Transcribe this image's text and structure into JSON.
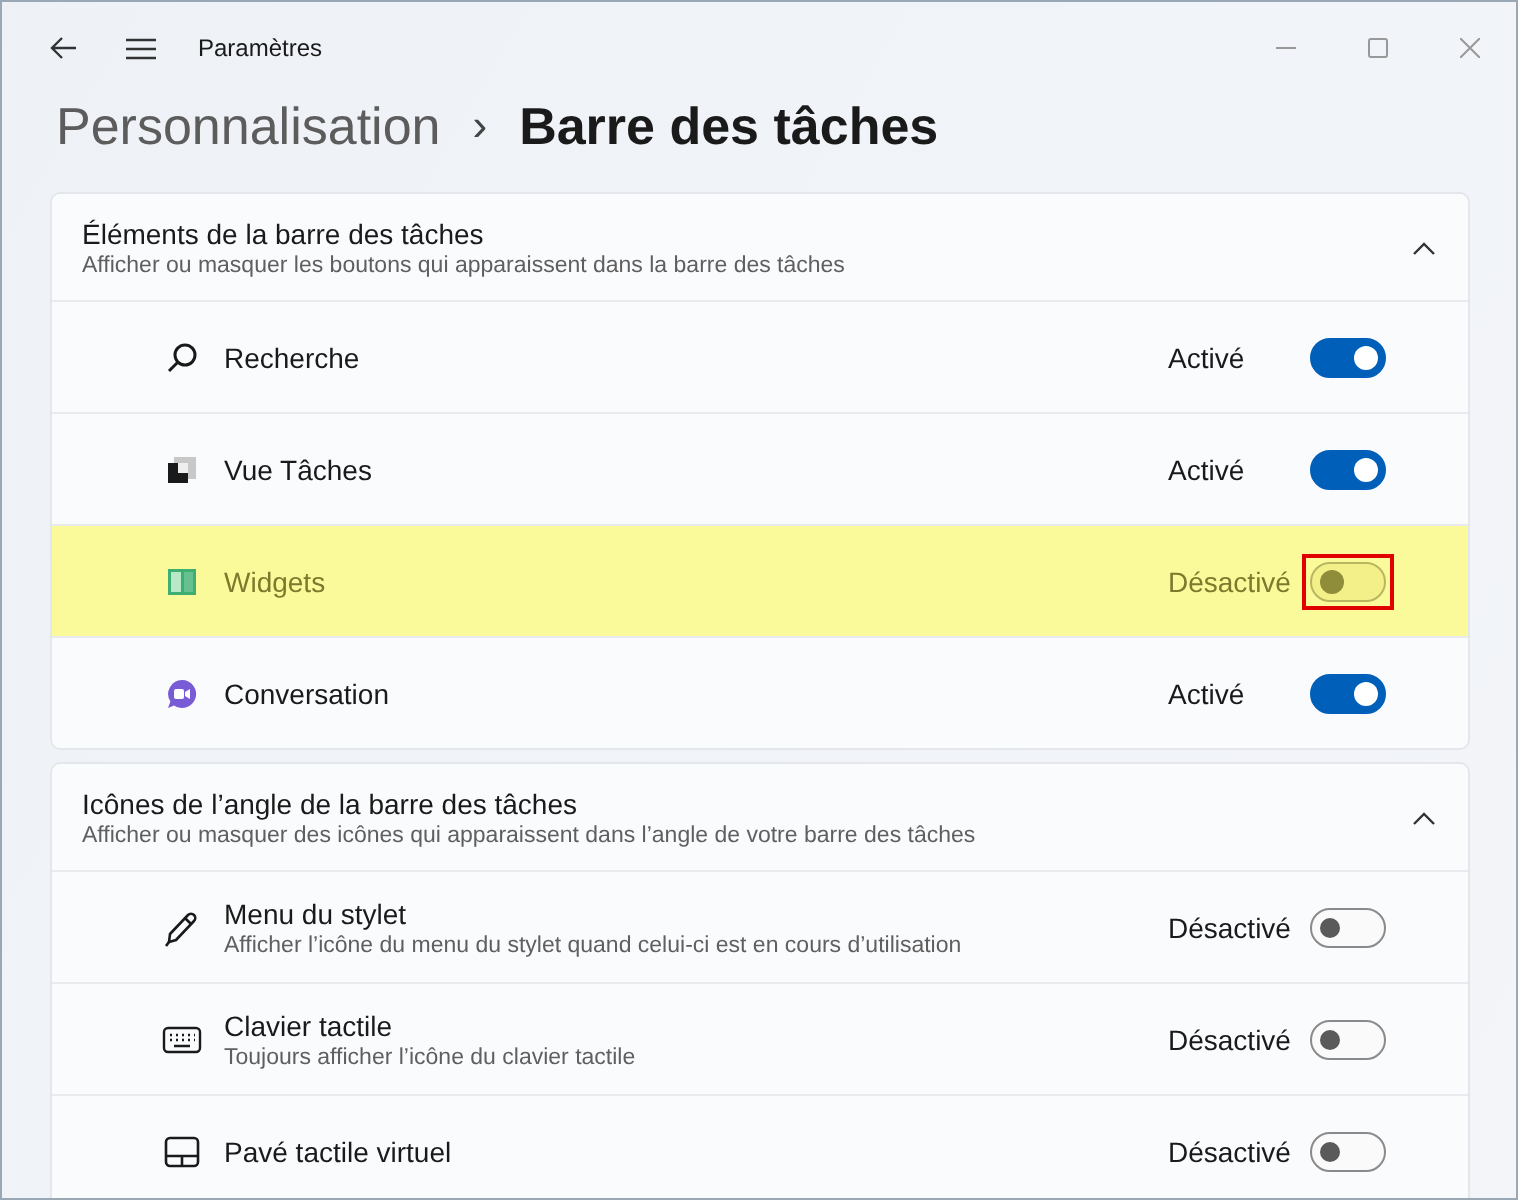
{
  "window": {
    "title": "Paramètres"
  },
  "breadcrumb": {
    "parent": "Personnalisation",
    "separator": "›",
    "current": "Barre des tâches"
  },
  "sections": [
    {
      "title": "Éléments de la barre des tâches",
      "description": "Afficher ou masquer les boutons qui apparaissent dans la barre des tâches",
      "expanded": true,
      "rows": [
        {
          "kind": "search",
          "label": "Recherche",
          "status": "Activé",
          "on": true,
          "highlighted": false
        },
        {
          "kind": "taskview",
          "label": "Vue Tâches",
          "status": "Activé",
          "on": true,
          "highlighted": false
        },
        {
          "kind": "widgets",
          "label": "Widgets",
          "status": "Désactivé",
          "on": false,
          "highlighted": true
        },
        {
          "kind": "chat",
          "label": "Conversation",
          "status": "Activé",
          "on": true,
          "highlighted": false
        }
      ]
    },
    {
      "title": "Icônes de l’angle de la barre des tâches",
      "description": "Afficher ou masquer des icônes qui apparaissent dans l’angle de votre barre des tâches",
      "expanded": true,
      "rows": [
        {
          "kind": "pen",
          "label": "Menu du stylet",
          "description": "Afficher l’icône du menu du stylet quand celui-ci est en cours d’utilisation",
          "status": "Désactivé",
          "on": false,
          "highlighted": false
        },
        {
          "kind": "keyboard",
          "label": "Clavier tactile",
          "description": "Toujours afficher l’icône du clavier tactile",
          "status": "Désactivé",
          "on": false,
          "highlighted": false
        },
        {
          "kind": "touchpad",
          "label": "Pavé tactile virtuel",
          "status": "Désactivé",
          "on": false,
          "highlighted": false
        }
      ]
    }
  ]
}
